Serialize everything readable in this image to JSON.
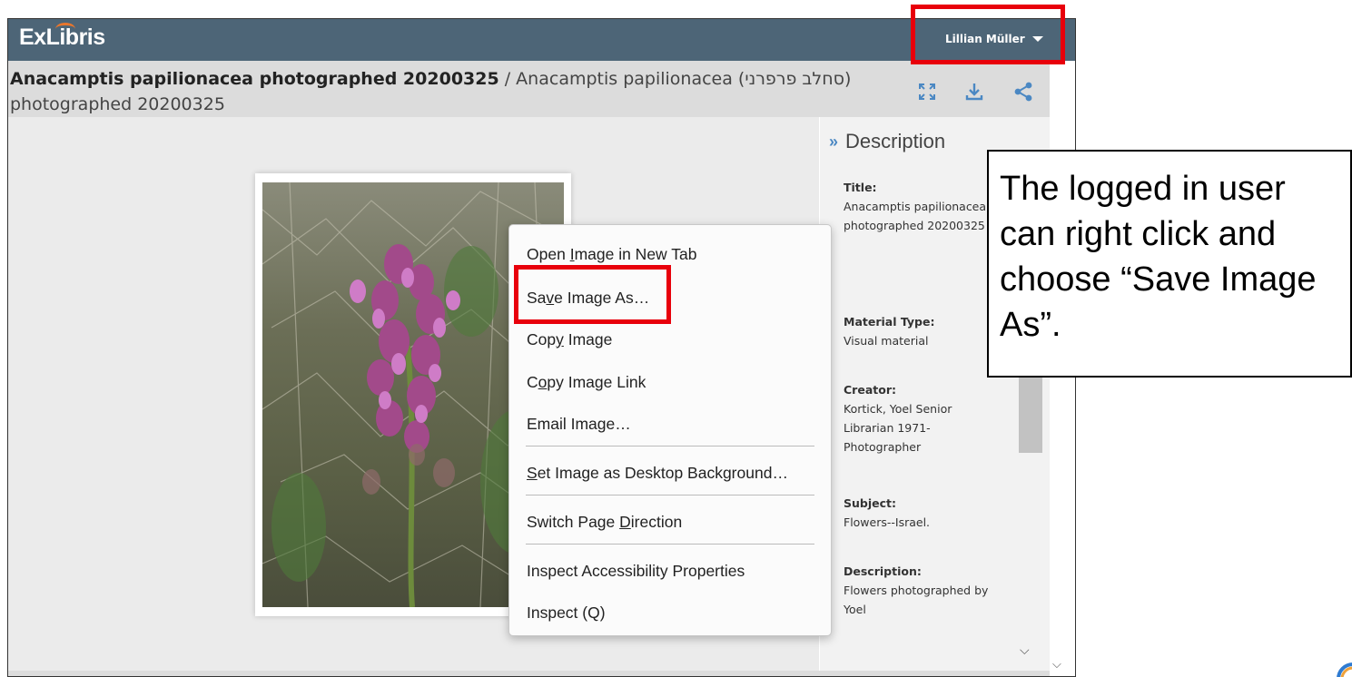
{
  "app": {
    "logo_text": "ExLibris",
    "user_name": "Lillian Müller"
  },
  "record": {
    "title_bold": "Anacamptis papilionacea photographed 20200325",
    "title_rest": " / Anacamptis papilionacea (סחלב פרפרני) photographed 20200325",
    "toolbar_icons": [
      "fullscreen-icon",
      "download-icon",
      "share-icon"
    ]
  },
  "description": {
    "header": "Description",
    "fields": [
      {
        "label": "Title:",
        "value": "Anacamptis papilionacea photographed 20200325"
      },
      {
        "label": "Material Type:",
        "value": "Visual material"
      },
      {
        "label": "Creator:",
        "value": "Kortick, Yoel Senior Librarian 1971- Photographer"
      },
      {
        "label": "Subject:",
        "value": "Flowers--Israel."
      },
      {
        "label": "Description:",
        "value": "Flowers photographed by Yoel"
      }
    ]
  },
  "context_menu": {
    "items": [
      {
        "label_pre": "Open ",
        "label_ul": "I",
        "label_post": "mage in New Tab"
      },
      {
        "label_pre": "Sa",
        "label_ul": "v",
        "label_post": "e Image As…"
      },
      {
        "label_pre": "Cop",
        "label_ul": "y",
        "label_post": " Image"
      },
      {
        "label_pre": "C",
        "label_ul": "o",
        "label_post": "py Image Link"
      },
      {
        "label_pre": "Email Image…",
        "label_ul": "",
        "label_post": ""
      },
      {
        "label_pre": "",
        "label_ul": "S",
        "label_post": "et Image as Desktop Background…"
      },
      {
        "label_pre": "Switch Page ",
        "label_ul": "D",
        "label_post": "irection"
      },
      {
        "label_pre": "Inspect Accessibility Properties",
        "label_ul": "",
        "label_post": ""
      },
      {
        "label_pre": "Inspect (Q)",
        "label_ul": "",
        "label_post": ""
      }
    ]
  },
  "callout": {
    "text": "The logged in user can right click and choose “Save Image As”."
  },
  "colors": {
    "header_bg": "#4d6577",
    "highlight_red": "#e8000b",
    "accent_blue": "#4b88c3"
  }
}
